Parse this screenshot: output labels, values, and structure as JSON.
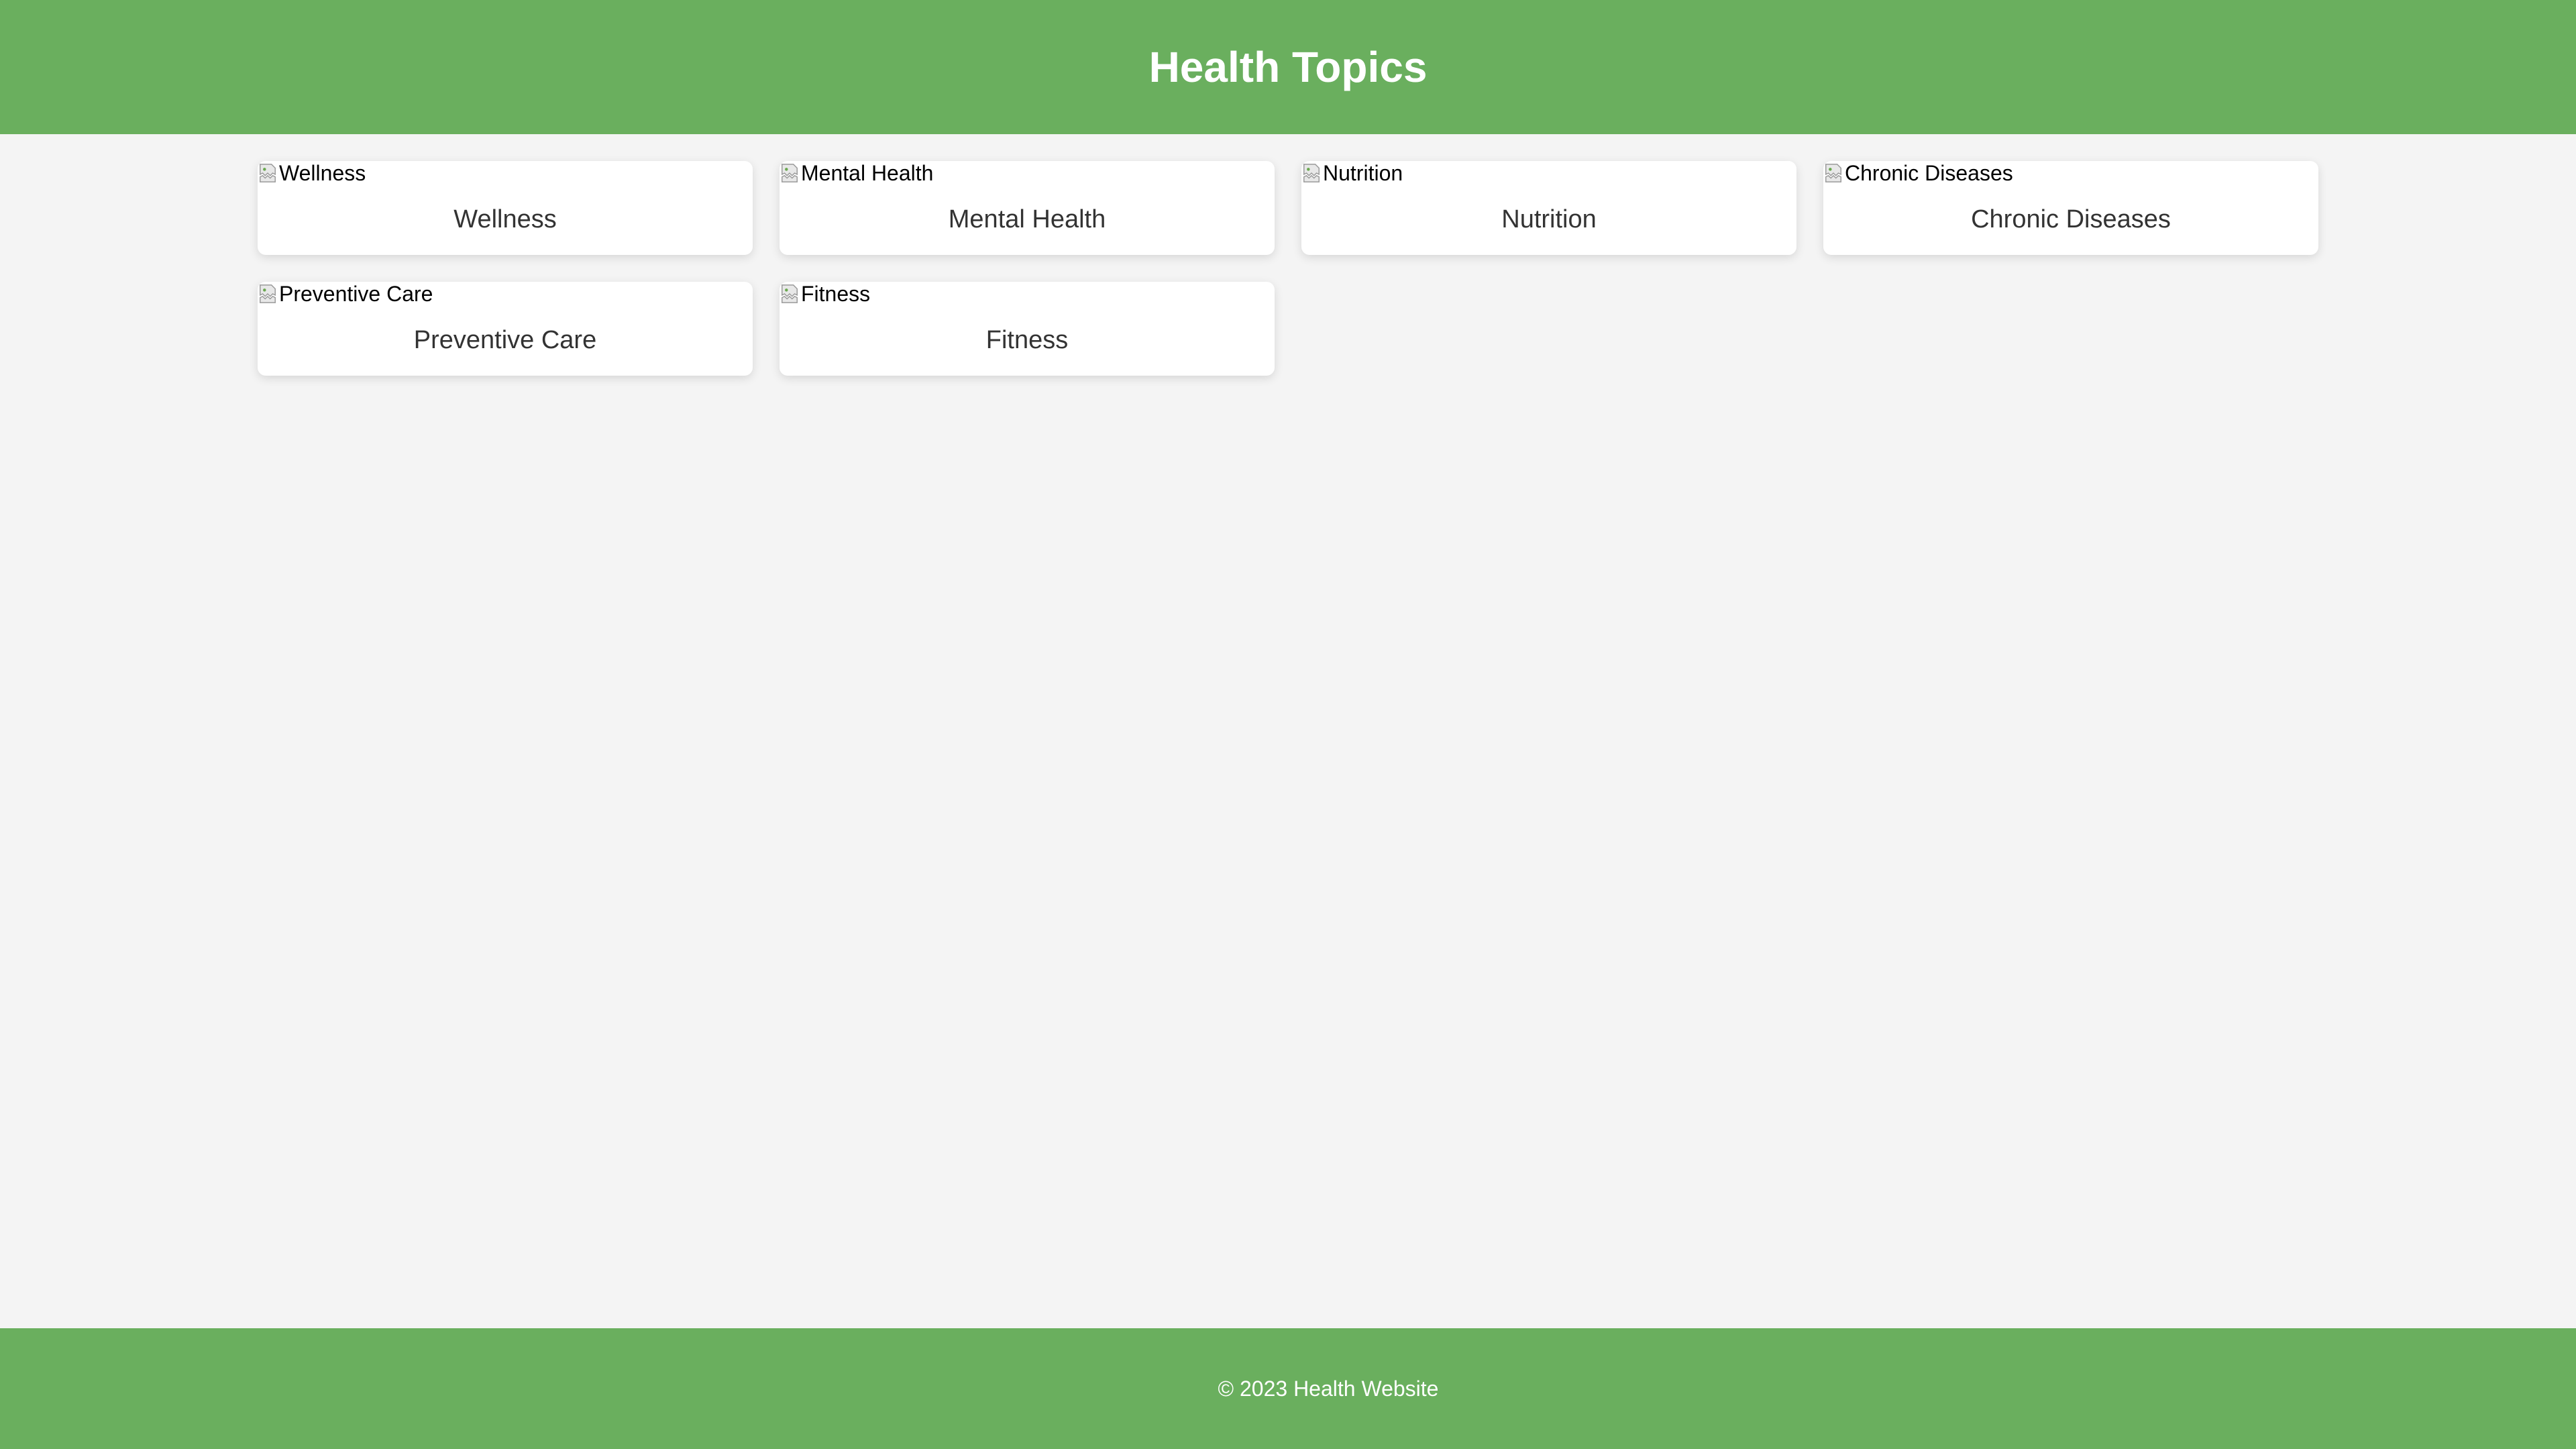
{
  "header": {
    "title": "Health Topics"
  },
  "topics": [
    {
      "alt": "Wellness",
      "title": "Wellness"
    },
    {
      "alt": "Mental Health",
      "title": "Mental Health"
    },
    {
      "alt": "Nutrition",
      "title": "Nutrition"
    },
    {
      "alt": "Chronic Diseases",
      "title": "Chronic Diseases"
    },
    {
      "alt": "Preventive Care",
      "title": "Preventive Care"
    },
    {
      "alt": "Fitness",
      "title": "Fitness"
    }
  ],
  "footer": {
    "text": "© 2023 Health Website"
  },
  "colors": {
    "brand_green": "#6aaf5e",
    "background": "#f4f4f4",
    "card": "#ffffff",
    "card_text": "#333333"
  },
  "icons": {
    "broken_image": "broken-image-icon"
  }
}
